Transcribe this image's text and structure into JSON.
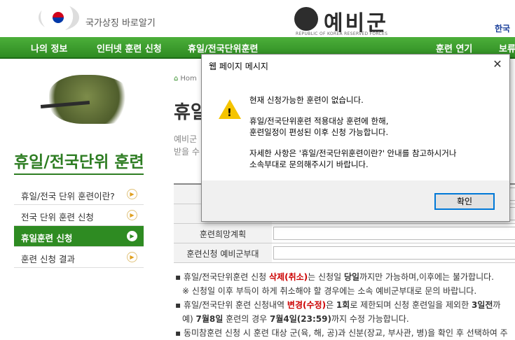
{
  "header": {
    "flag_label": "국가상징 바로알기",
    "brand": "예비군",
    "brand_sub": "REPUBLIC OF KOREA RESERVED FORCES",
    "top_link": "한국"
  },
  "nav": {
    "items": [
      "나의 정보",
      "인터넷 훈련 신청",
      "휴일/전국단위훈련",
      "훈련 연기",
      "보류"
    ]
  },
  "sidebar": {
    "title": "휴일/전국단위 훈련",
    "items": [
      {
        "label": "휴일/전국 단위 훈련이란?"
      },
      {
        "label": "전국 단위 훈련 신청"
      },
      {
        "label": "휴일훈련 신청"
      },
      {
        "label": "훈련 신청 결과"
      }
    ]
  },
  "main": {
    "breadcrumb": "Hom",
    "title": "휴일",
    "desc_lines": [
      "예비군",
      "받을 수"
    ],
    "rows": [
      {
        "label": ""
      },
      {
        "label": ""
      },
      {
        "label": "훈련희망계획"
      },
      {
        "label": "훈련신청 예비군부대"
      }
    ]
  },
  "notes": {
    "l1a": "▪ 휴일/전국단위훈련 신청 ",
    "l1b": "삭제(취소)",
    "l1c": "는 신청일 ",
    "l1d": "당일",
    "l1e": "까지만 가능하며,이후에는 불가합니다.",
    "l2": "※ 신청일 이후 부득이 하게 취소해야 할 경우에는 소속 예비군부대로 문의 바랍니다.",
    "l3a": "▪ 휴일/전국단위 훈련 신청내역 ",
    "l3b": "변경(수정)",
    "l3c": "은 ",
    "l3d": "1회",
    "l3e": "로 제한되며 신청 훈련일을 제외한 ",
    "l3f": "3일전",
    "l3g": "까",
    "l4a": "예) ",
    "l4b": "7월8일",
    "l4c": " 훈련의 경우 ",
    "l4d": "7월4일(23:59)",
    "l4e": "까지 수정 가능합니다.",
    "l5": "▪ 동미참훈련 신청 시 훈련 대상 군(육, 해, 공)과 신분(장교, 부사관, 병)을 확인 후 선택하여 주"
  },
  "dialog": {
    "title": "웹 페이지 메시지",
    "close": "✕",
    "lines": [
      "현재 신청가능한 훈련이 없습니다.",
      "휴일/전국단위훈련 적용대상 훈련에 한해,",
      "훈련일정이 편성된 이후 신청 가능합니다.",
      "자세한 사항은 '휴일/전국단위훈련이란?' 안내를 참고하시거나",
      "소속부대로 문의해주시기 바랍니다."
    ],
    "ok_label": "확인",
    "warn_mark": "!"
  }
}
